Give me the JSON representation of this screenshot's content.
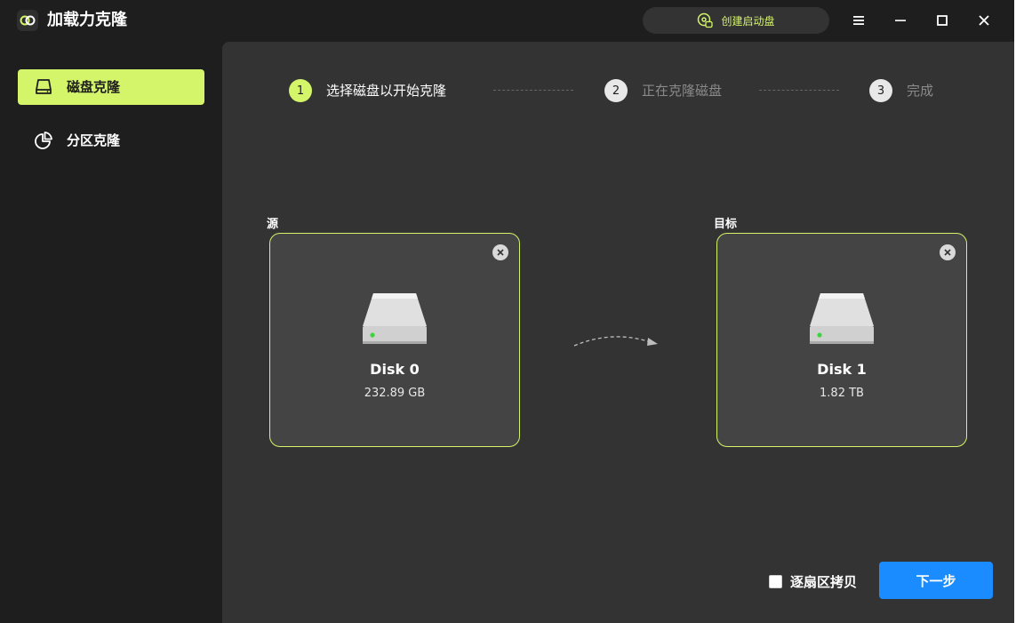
{
  "app": {
    "title": "加载力克隆"
  },
  "titlebar": {
    "boot_label": "创建启动盘"
  },
  "sidebar": {
    "items": [
      {
        "label": "磁盘克隆",
        "icon": "disk-icon",
        "active": true
      },
      {
        "label": "分区克隆",
        "icon": "pie-chart-icon",
        "active": false
      }
    ]
  },
  "steps": [
    {
      "number": "1",
      "label": "选择磁盘以开始克隆",
      "state": "current"
    },
    {
      "number": "2",
      "label": "正在克隆磁盘",
      "state": "pending"
    },
    {
      "number": "3",
      "label": "完成",
      "state": "pending"
    }
  ],
  "source": {
    "caption": "源",
    "disk_name": "Disk 0",
    "disk_size": "232.89 GB"
  },
  "target": {
    "caption": "目标",
    "disk_name": "Disk 1",
    "disk_size": "1.82 TB"
  },
  "footer": {
    "sector_label": "逐扇区拷贝",
    "sector_checked": false,
    "next_label": "下一步"
  },
  "colors": {
    "accent": "#d4f46a",
    "primary": "#1a8cff",
    "background": "#1e1e1e",
    "panel": "#333333",
    "card": "#444444",
    "led": "#3cd43c"
  }
}
